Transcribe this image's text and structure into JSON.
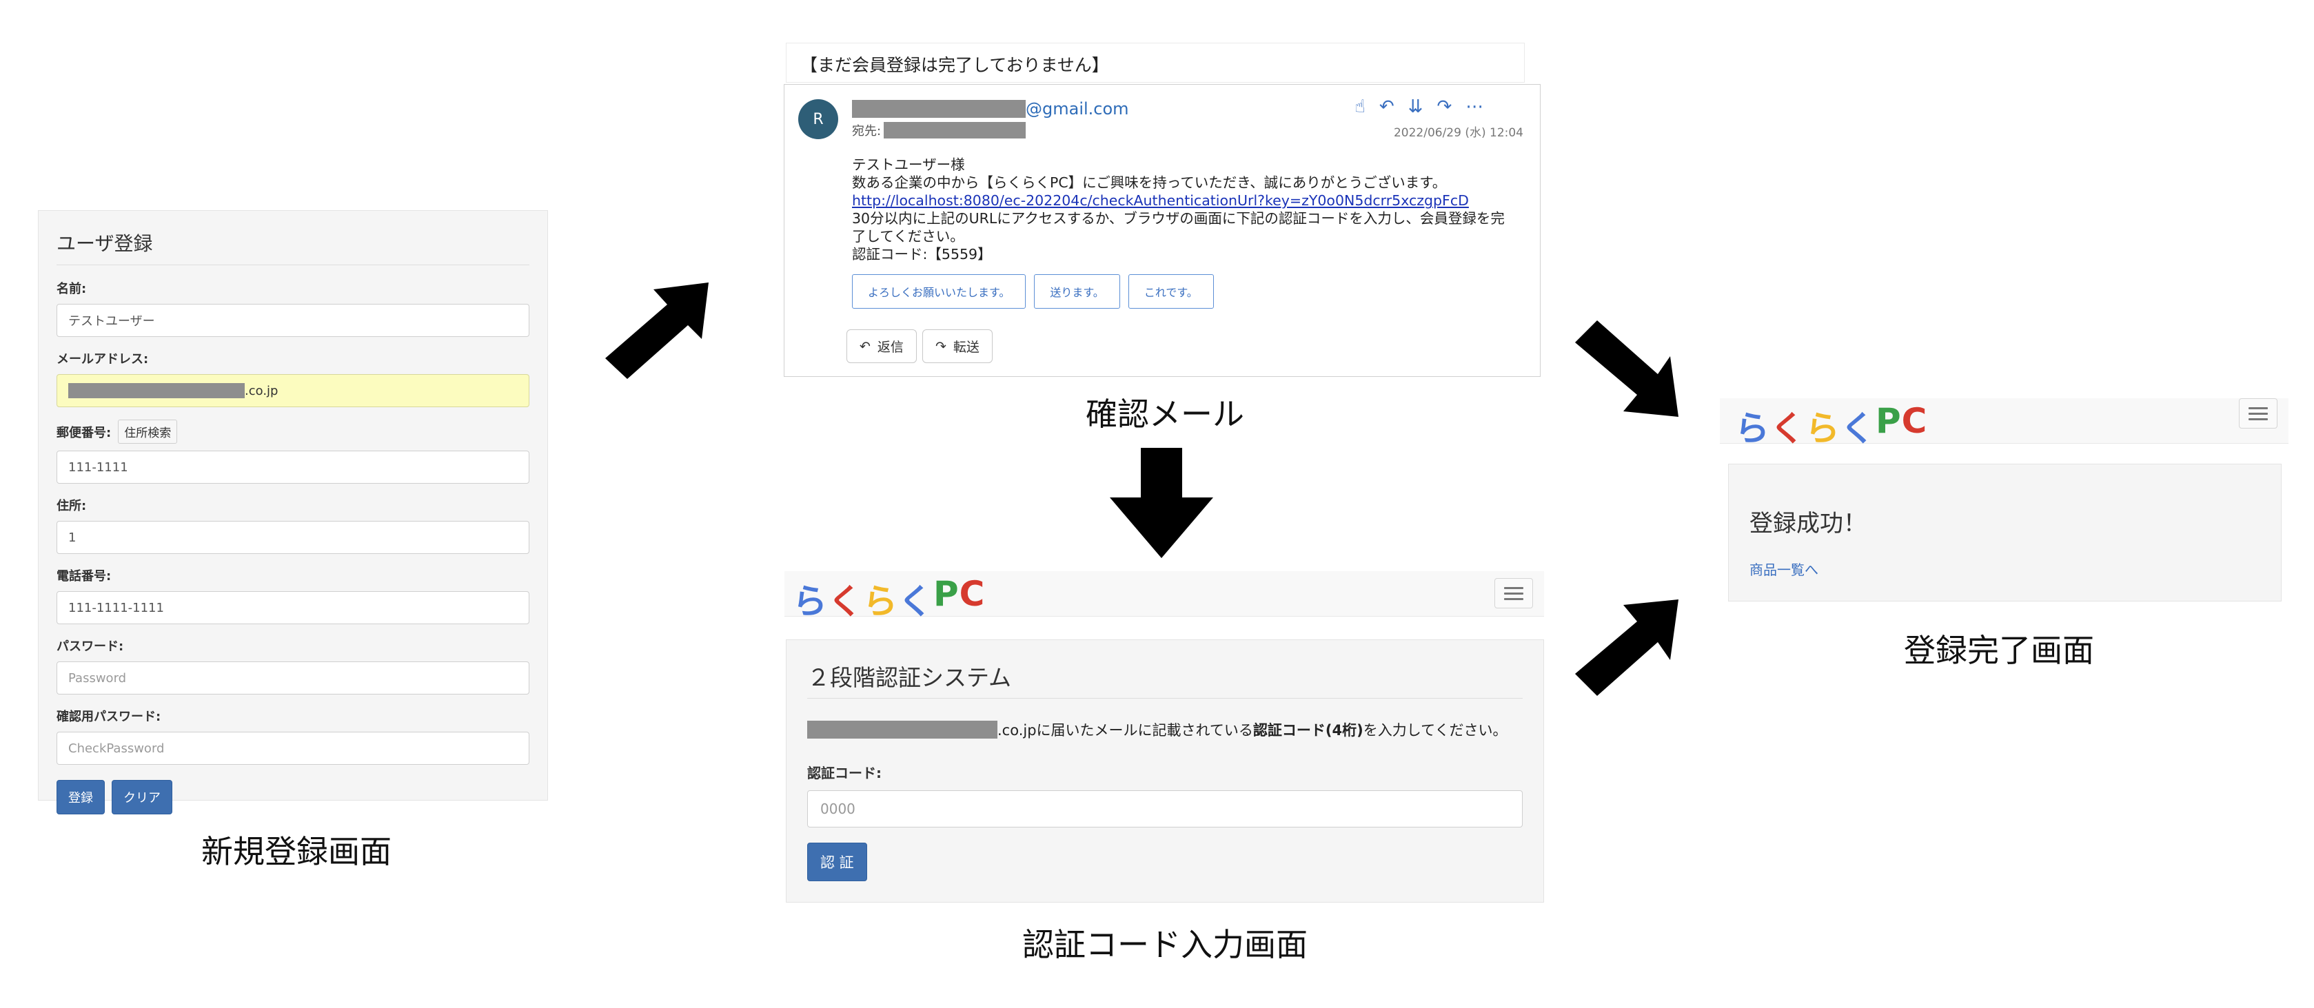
{
  "registration": {
    "title": "ユーザ登録",
    "name_label": "名前:",
    "name_value": "テストユーザー",
    "email_label": "メールアドレス:",
    "email_suffix": ".co.jp",
    "zip_label": "郵便番号:",
    "zip_search": "住所検索",
    "zip_value": "111-1111",
    "address_label": "住所:",
    "address_value": "1",
    "phone_label": "電話番号:",
    "phone_value": "111-1111-1111",
    "password_label": "パスワード:",
    "password_placeholder": "Password",
    "confirm_label": "確認用パスワード:",
    "confirm_placeholder": "CheckPassword",
    "register_button": "登録",
    "clear_button": "クリア",
    "caption": "新規登録画面"
  },
  "email": {
    "subject": "【まだ会員登録は完了しておりません】",
    "avatar": "R",
    "from_suffix": "@gmail.com",
    "to_label": "宛先:",
    "date": "2022/06/29 (水) 12:04",
    "greeting": "テストユーザー様",
    "line1": "数ある企業の中から【らくらくPC】にご興味を持っていただき、誠にありがとうございます。",
    "link": "http://localhost:8080/ec-202204c/checkAuthenticationUrl?key=zY0o0N5dcrr5xczgpFcD",
    "line2": "30分以内に上記のURLにアクセスするか、ブラウザの画面に下記の認証コードを入力し、会員登録を完了してください。",
    "code_line": "認証コード:【5559】",
    "quick_replies": [
      "よろしくお願いいたします。",
      "送ります。",
      "これです。"
    ],
    "reply_button": "返信",
    "forward_button": "転送",
    "caption": "確認メール"
  },
  "brand": {
    "letters": [
      "ら",
      "く",
      "ら",
      "く",
      "P",
      "C"
    ],
    "colors": [
      "#4a78d8",
      "#d63a2e",
      "#f2b92a",
      "#4a78d8",
      "#3aa048",
      "#d63a2e"
    ]
  },
  "auth": {
    "title": "２段階認証システム",
    "msg_suffix": ".co.jpに届いたメールに記載されている",
    "msg_bold": "認証コード(4桁)",
    "msg_end": "を入力してください。",
    "code_label": "認証コード:",
    "code_placeholder": "0000",
    "submit_button": "認 証",
    "caption": "認証コード入力画面"
  },
  "success": {
    "title": "登録成功！",
    "link": "商品一覧へ",
    "caption": "登録完了画面"
  }
}
